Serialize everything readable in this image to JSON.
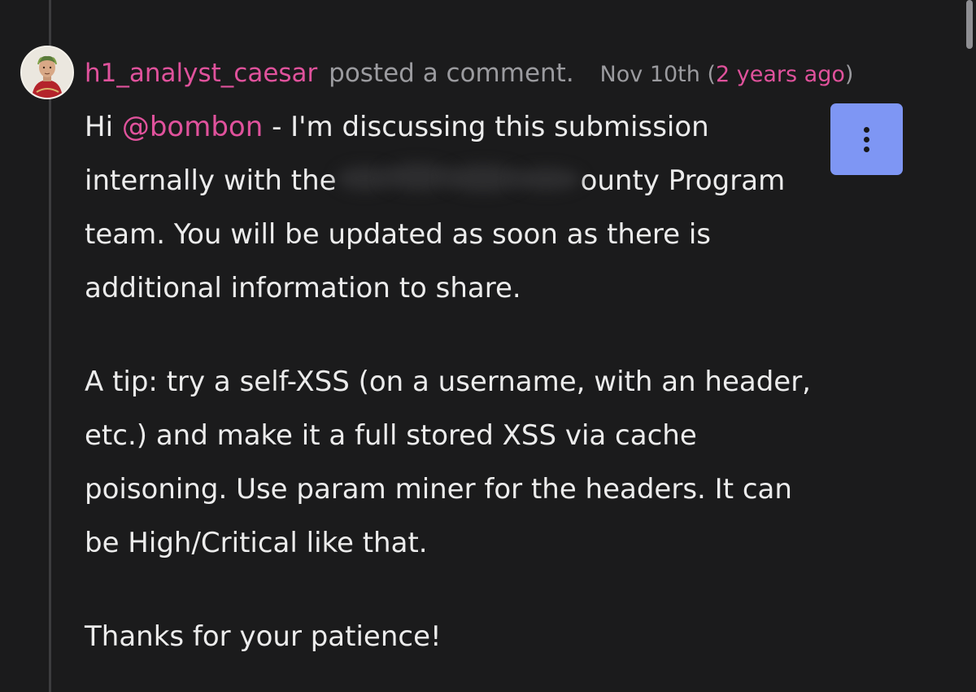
{
  "comment": {
    "author": "h1_analyst_caesar",
    "action": "posted a comment.",
    "date": "Nov 10th",
    "relative_time_open": "(",
    "relative_time": "2 years ago",
    "relative_time_close": ")",
    "avatar_icon": "roman-bust-avatar-icon",
    "menu_icon": "vertical-ellipsis-icon",
    "body": {
      "p1": {
        "line1_prefix": "Hi ",
        "mention": "@bombon",
        "line1_suffix": " - I'm discussing this submission",
        "line2_prefix": "internally with the",
        "line2_suffix": "ounty Program",
        "line3": "team. You will be updated as soon as there is",
        "line4": "additional information to share."
      },
      "p2": {
        "line1": "A tip: try a self-XSS (on a username, with an header,",
        "line2": "etc.) and make it a full stored XSS via cache",
        "line3": "poisoning. Use param miner for the headers. It can",
        "line4": "be High/Critical like that."
      },
      "p3": {
        "line1": "Thanks for your patience!"
      }
    }
  },
  "colors": {
    "background": "#1b1b1c",
    "accent_pink": "#e0529c",
    "muted_text": "#9b9b9f",
    "body_text": "#ececec",
    "menu_button": "#7e96f4"
  }
}
